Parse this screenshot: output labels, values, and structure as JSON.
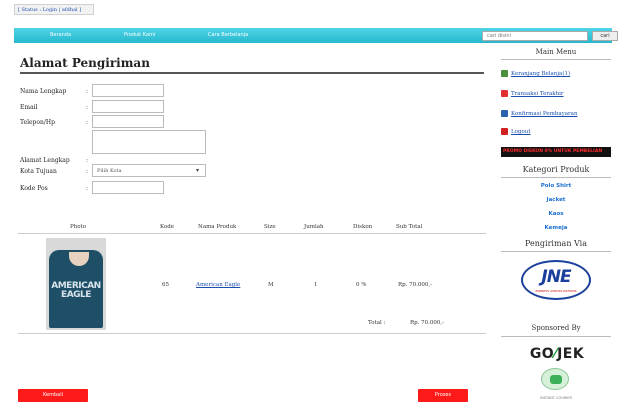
{
  "topbar": {
    "status_text": "[ Status : Login | afdhal ]"
  },
  "nav": {
    "items": [
      "Beranda",
      "Produk Kami",
      "Cara Berbelanja"
    ],
    "search_placeholder": "cari disini",
    "search_button": "cari"
  },
  "main": {
    "title": "Alamat Pengiriman",
    "form": {
      "labels": [
        "Nama Lengkap",
        "Email",
        "Telepon/Hp",
        "Alamat Lengkap",
        "Kota Tujuan",
        "Kode Pos"
      ],
      "colon": ":",
      "city_select_value": "Pilih Kota"
    },
    "table": {
      "headers": [
        "Photo",
        "Kode",
        "Nama Produk",
        "Size",
        "Jumlah",
        "Diskon",
        "Sub Total"
      ],
      "rows": [
        {
          "kode": "65",
          "nama": "American Eagle",
          "size": "M",
          "jumlah": "1",
          "diskon": "0 %",
          "subtotal": "Rp. 70.000,-",
          "shirt_print": "AMERICAN EAGLE"
        }
      ]
    },
    "total_label": "Total :",
    "total_value": "Rp. 70.000,-",
    "left_button": "Kembali",
    "right_button": "Proses"
  },
  "sidebar": {
    "main_menu_title": "Main Menu",
    "menu_items": [
      {
        "label": "Keranjang Belanja(1)",
        "icon": "cart-icon",
        "color": "#4a8f3a"
      },
      {
        "label": "Transaksi Terakhir",
        "icon": "transaction-icon",
        "color": "#e03030"
      },
      {
        "label": "Konfirmasi Pembayaran",
        "icon": "payment-icon",
        "color": "#2b5fb0"
      },
      {
        "label": "Logout",
        "icon": "logout-icon",
        "color": "#d02020"
      }
    ],
    "promo_text": "PROMO DISKON 0% UNTUK PEMBELIAN",
    "category_title": "Kategori Produk",
    "categories": [
      "Polo Shirt",
      "Jacket",
      "Kaos",
      "Kemeja"
    ],
    "shipping_title": "Pengiriman Via",
    "jne_logo": "JNE",
    "jne_tagline": "EXPRESS ACROSS NATIONS",
    "sponsor_title": "Sponsored By",
    "gojek_logo_left": "GO",
    "gojek_logo_right": "JEK",
    "gojek_tagline": "INSTANT COURIER"
  },
  "colors": {
    "nav": "#26b8cc",
    "button": "#ff1a1a",
    "link": "#1a4fb0"
  }
}
